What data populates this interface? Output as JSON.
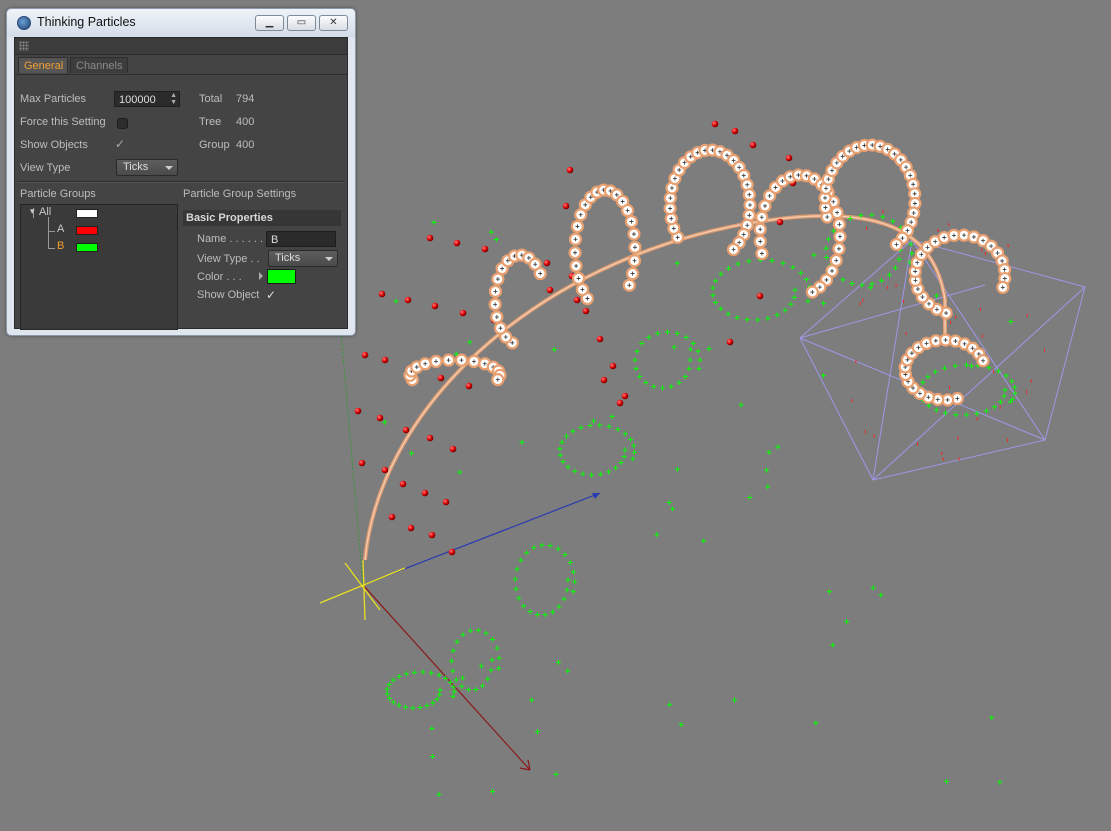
{
  "window": {
    "title": "Thinking Particles",
    "icon": "cinema4d-logo-icon"
  },
  "tabs": [
    {
      "label": "General",
      "active": true
    },
    {
      "label": "Channels",
      "active": false
    }
  ],
  "general": {
    "max_particles_label": "Max Particles",
    "max_particles_value": "100000",
    "force_label": "Force this Setting",
    "force_checked": false,
    "show_objects_label": "Show Objects",
    "show_objects_checked": true,
    "view_type_label": "View Type",
    "view_type_value": "Ticks",
    "total_label": "Total",
    "total_value": "794",
    "tree_label": "Tree",
    "tree_value": "400",
    "group_label": "Group",
    "group_value": "400"
  },
  "groups": {
    "header": "Particle Groups",
    "items": [
      {
        "label": "All",
        "color": "#ffffff"
      },
      {
        "label": "A",
        "color": "#ff0000"
      },
      {
        "label": "B",
        "color": "#00ff00",
        "selected": true
      }
    ]
  },
  "settings": {
    "header": "Particle Group Settings",
    "section": "Basic Properties",
    "name_label": "Name . . . . . .",
    "name_value": "B",
    "view_type_label": "View Type . .",
    "view_type_value": "Ticks",
    "color_label": "Color . . .",
    "color_value": "#00ff00",
    "show_object_label": "Show Object",
    "show_object_checked": true
  },
  "viewport": {
    "background": "#7d7d7d",
    "group_a_color": "#ff0000",
    "group_b_color": "#00ff00",
    "trail_color": "#e8a070"
  }
}
